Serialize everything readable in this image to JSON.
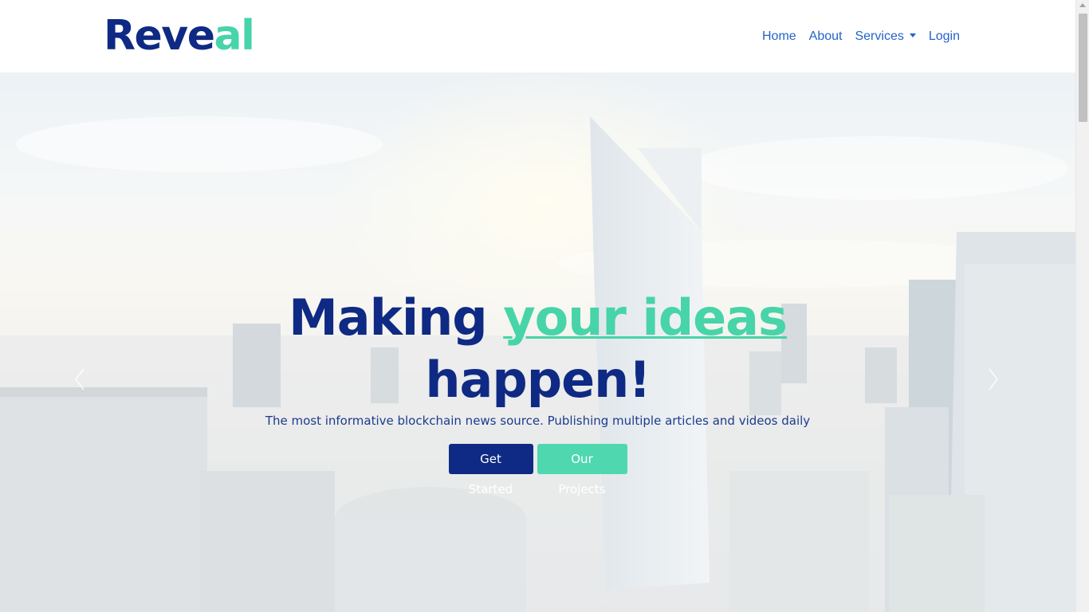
{
  "brand": {
    "part1": "Reve",
    "part2": "al"
  },
  "nav": {
    "home": "Home",
    "about": "About",
    "services": "Services",
    "login": "Login"
  },
  "hero": {
    "title_part1": "Making ",
    "title_accent": "your ideas",
    "title_part2": "happen!",
    "subtitle": "The most informative blockchain news source. Publishing multiple articles and videos daily",
    "primary_button": "Get Started",
    "secondary_button": "Our Projects"
  },
  "icons": {
    "dropdown": "caret-down-icon",
    "prev": "chevron-left-icon",
    "next": "chevron-right-icon"
  },
  "colors": {
    "brand_dark": "#0f2a84",
    "brand_accent": "#47d4a8",
    "nav_link": "#2463c9"
  }
}
